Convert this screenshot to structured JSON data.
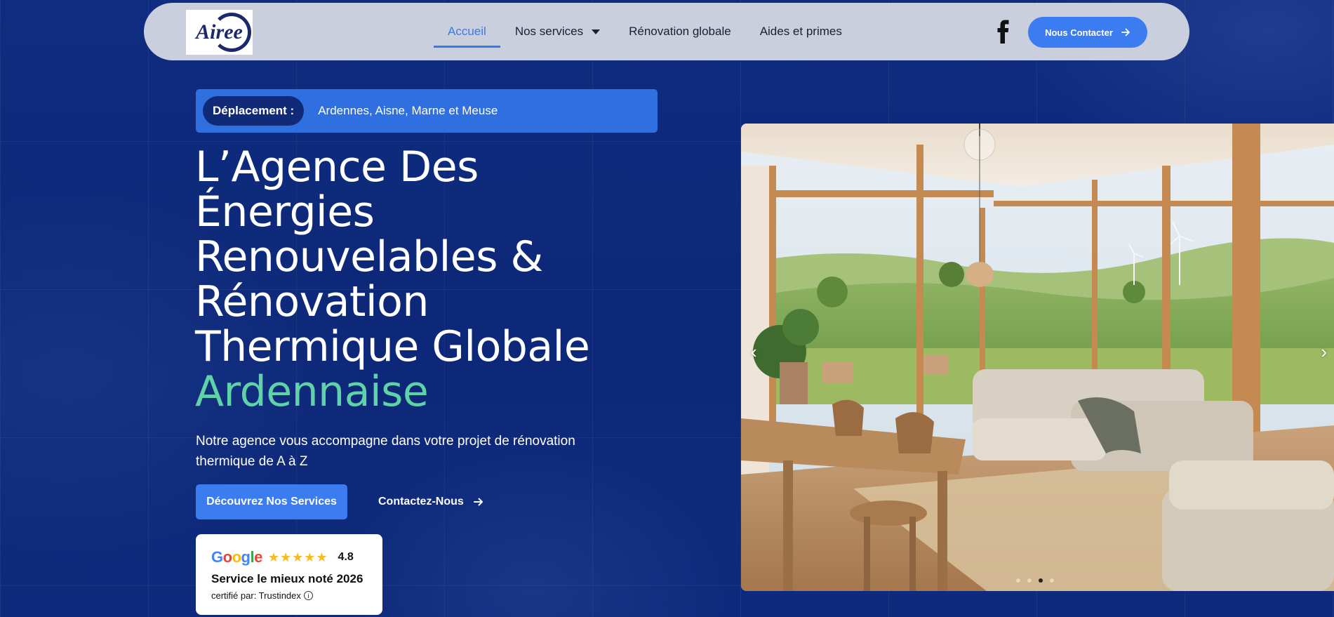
{
  "nav": {
    "logo_text": "Airee",
    "links": [
      {
        "label": "Accueil",
        "active": true
      },
      {
        "label": "Nos services",
        "dropdown": true
      },
      {
        "label": "Rénovation globale"
      },
      {
        "label": "Aides et primes"
      }
    ],
    "social_icon": "facebook-icon",
    "cta_label": "Nous Contacter",
    "cta_icon": "arrow-right-icon"
  },
  "location": {
    "label": "Déplacement :",
    "value": "Ardennes, Aisne, Marne et Meuse"
  },
  "hero": {
    "title_lines": [
      "L’Agence Des",
      "Énergies",
      "Renouvelables &",
      "Rénovation",
      "Thermique Globale"
    ],
    "title_accent": "Ardennaise",
    "subtitle": "Notre agence vous accompagne dans votre projet de rénovation thermique de A à Z",
    "primary_button": "Découvrez Nos Services",
    "secondary_button": "Contactez-Nous"
  },
  "review": {
    "brand": "Google",
    "stars": "★★★★★",
    "rating": "4.8",
    "title": "Service le mieux noté 2026",
    "certified": "certifié par: Trustindex",
    "info_icon": "i"
  },
  "slider": {
    "image_alt": "Living room with wooden beams and large windows overlooking green hills and wind turbines",
    "prev_icon": "chevron-left-icon",
    "next_icon": "chevron-right-icon",
    "dots": 4,
    "active_dot": 3
  },
  "colors": {
    "background": "#0e2a7e",
    "primary": "#3b7cf0",
    "accent": "#5fd3a7",
    "nav_bg": "#c9cfdd"
  }
}
